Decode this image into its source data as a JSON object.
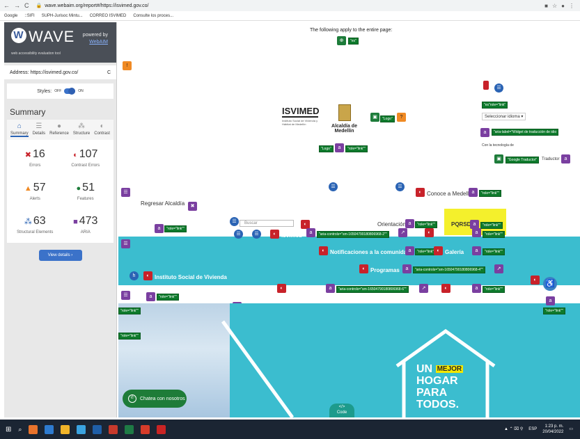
{
  "browser": {
    "address": "wave.webaim.org/report#/https://isvimed.gov.co/",
    "bookmarks": [
      "Google",
      "::SIFI",
      "SUPH-Jurisoc Mintu...",
      "CORREO ISVIMED",
      "Consulte los proces..."
    ]
  },
  "wave": {
    "logo": "WAVE",
    "tagline": "web accessibility evaluation tool",
    "powered_by": "powered by",
    "webaim": "WebAIM",
    "address_label": "Address:",
    "address_value": "https://isvimed.gov.co/",
    "styles_label": "Styles:",
    "styles_off": "OFF",
    "styles_on": "ON",
    "summary_title": "Summary",
    "tabs": [
      {
        "label": "Summary",
        "icon": "home-icon"
      },
      {
        "label": "Details",
        "icon": "list-icon"
      },
      {
        "label": "Reference",
        "icon": "info-icon"
      },
      {
        "label": "Structure",
        "icon": "structure-icon"
      },
      {
        "label": "Contrast",
        "icon": "contrast-icon"
      }
    ],
    "stats": [
      {
        "value": "16",
        "label": "Errors",
        "color": "#c8222a"
      },
      {
        "value": "107",
        "label": "Contrast Errors",
        "color": "#c8222a"
      },
      {
        "value": "57",
        "label": "Alerts",
        "color": "#f08a24"
      },
      {
        "value": "51",
        "label": "Features",
        "color": "#1d7c3a"
      },
      {
        "value": "63",
        "label": "Structural Elements",
        "color": "#2a63b4"
      },
      {
        "value": "473",
        "label": "ARIA",
        "color": "#7a3fa0"
      }
    ],
    "details_button": "View details ›"
  },
  "page": {
    "apply_text": "The following apply to the entire page:",
    "lang_tag": "\"es\"",
    "isvimed_logo": "ISVIMED",
    "isvimed_sub": "Instituto Social de Vivienda y Hábitat de Medellín",
    "alcaldia": "Alcaldía de Medellín",
    "logo_tag": "\"Logo\"",
    "role_link": "\"role=\"link\"\"",
    "idioma_tag": "\"es\"role=\"link\"",
    "idioma_select": "Seleccionar idioma ▾",
    "widget_tag": "\"aria-label=\"Widget de traducción de idio",
    "google_tech": "Con la tecnología de",
    "google_tag": "\"Google Traductor\"",
    "traductor": "Traductor",
    "conoce": "Conoce a Medellín",
    "regresar": "Regresar Alcaldía",
    "buscar": "Buscar",
    "isvimed_menu": "Isvimed",
    "orientacion": "Orientación",
    "pqrsd": "PQRSD",
    "aria_controls_1": "\"aria-controls=\"sm-16504790180806968-2\"\"",
    "aria_controls_2": "\"aria-controls=\"sm-16504790180806968-4\"\"",
    "aria_controls_3": "\"aria-controls=\"sm-16504790180806968-6\"\"",
    "notificaciones": "Notificaciones a la comunidad",
    "galeria": "Galería",
    "programas": "Programas",
    "instituto": "Instituto Social de Vivienda",
    "house_line1": "UN",
    "house_mejor": "MEJOR",
    "house_line2": "HOGAR",
    "house_line3": "PARA",
    "house_line4": "TODOS.",
    "chat": "Chatea con nosotros",
    "code": "Code"
  },
  "taskbar": {
    "time": "1:23 p. m.",
    "date": "20/04/2022",
    "lang": "ESP"
  }
}
